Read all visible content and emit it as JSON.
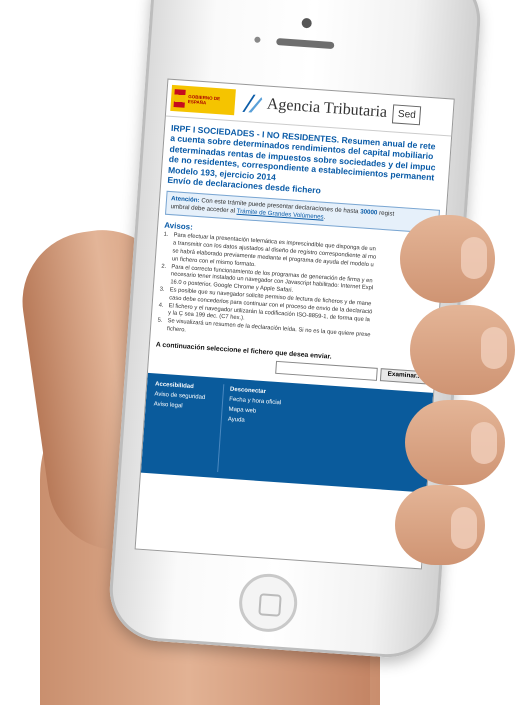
{
  "header": {
    "gov_logo_text": "GOBIERNO DE ESPAÑA",
    "agency_name": "Agencia Tributaria",
    "search_label": "Sed"
  },
  "page_title_lines": [
    "IRPF I SOCIEDADES - I NO RESIDENTES. Resumen anual de rete",
    "a cuenta sobre determinados rendimientos del capital mobiliario",
    "determinadas rentas de impuestos sobre sociedades y del impuc",
    "de no residentes, correspondiente a establecimientos permanent",
    "Modelo 193, ejercicio 2014",
    "Envío de declaraciones desde fichero"
  ],
  "attention": {
    "label": "Atención:",
    "text_before": " Con este trámite puede presentar declaraciones de hasta ",
    "limit": "30000",
    "text_after": " regist",
    "line2_before": "umbral debe acceder al ",
    "link": "Trámite de Grandes Volúmenes",
    "line2_after": "."
  },
  "avisos_title": "Avisos:",
  "avisos": [
    {
      "n": "1.",
      "lines": [
        "Para efectuar la presentación telemática es imprescindible que disponga de un",
        "a transmitir con los datos ajustados al diseño de registro correspondiente al mo",
        "se habrá elaborado previamente mediante el programa de ayuda del modelo u",
        "un fichero con el mismo formato."
      ]
    },
    {
      "n": "2.",
      "lines": [
        "Para el correcto funcionamiento de los programas de generación de firma y en",
        "necesario tener instalado un navegador con Javascript habilitado: Internet Expl",
        "16.0 o posterior, Google Chrome y Apple Safari."
      ]
    },
    {
      "n": "3.",
      "lines": [
        "Es posible que su navegador solicite permiso de lectura de ficheros y de mane",
        "caso debe concederlos para continuar con el proceso de envío de la declaració"
      ]
    },
    {
      "n": "4.",
      "lines": [
        "El fichero y el navegador utilizarán la codificación ISO-8859-1, de forma que la",
        "y la Ç sea 199 dec. (C7 hex.)."
      ]
    },
    {
      "n": "5.",
      "lines": [
        "Se visualizará un resumen de la declaración leída. Si no es la que quiere prese",
        "fichero."
      ]
    }
  ],
  "select_prompt": "A continuación seleccione el fichero que desea enviar.",
  "browse_label": "Examinar...",
  "footer": {
    "col1": [
      "Accesibilidad",
      "Aviso de seguridad",
      "Aviso legal"
    ],
    "col2": [
      "Desconectar",
      "Fecha y hora oficial",
      "Mapa web",
      "Ayuda"
    ]
  },
  "colors": {
    "accent": "#0b5ca8",
    "footer_bg": "#0a5b9c",
    "gov_yellow": "#f5c400"
  }
}
